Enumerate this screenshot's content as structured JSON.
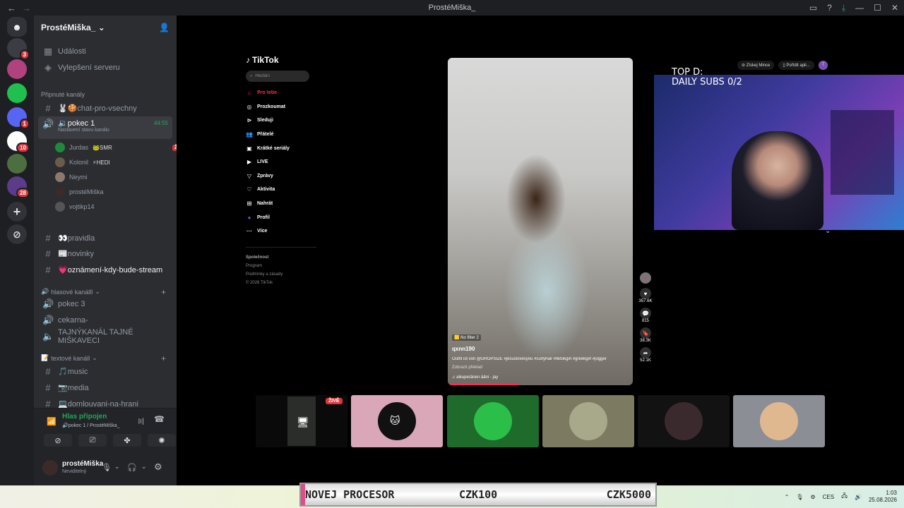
{
  "window": {
    "title": "ProstéMiška_"
  },
  "server": {
    "name": "ProstéMiška_"
  },
  "sidebar": {
    "events": "Události",
    "boost": "Vylepšení serveru",
    "pinned_category": "Připnuté kanály",
    "channels_pinned": [
      {
        "label": "🐰🍪chat-pro-vsechny"
      }
    ],
    "voice_active": {
      "label": "pokec 1",
      "status": "Nastavení stavu kanálu",
      "timer": "44:55"
    },
    "voice_users": [
      {
        "name": "Jurdas",
        "tag": "SMR",
        "live": "ŽIVĚ"
      },
      {
        "name": "Kolonil",
        "tag": "HEDI"
      },
      {
        "name": "Neymi"
      },
      {
        "name": "prostéMiška"
      },
      {
        "name": "vojtikp14"
      }
    ],
    "channels_text": [
      {
        "label": "👀pravidla"
      },
      {
        "label": "📰novinky"
      },
      {
        "label": "💗oznámení-kdy-bude-stream"
      }
    ],
    "voice_category": "hlasové kanálll",
    "voice_channels": [
      {
        "label": "pokec 3"
      },
      {
        "label": "cekarna-"
      },
      {
        "label": "TAJNÝKANÁL TAJNÉ MIŠKAVECI"
      }
    ],
    "text_category": "textové kanáll",
    "text_channels": [
      {
        "label": "🎵music"
      },
      {
        "label": "📷media"
      },
      {
        "label": "💻domlouvani-na-hrani"
      }
    ]
  },
  "voice_panel": {
    "status": "Hlas připojen",
    "channel": "pokec 1 / ProstéMiška_"
  },
  "user_panel": {
    "name": "prostéMiška",
    "status": "Neviditelný"
  },
  "servers": [
    {
      "badge": "3",
      "color": "#3b3d44"
    },
    {
      "badge": "",
      "color": "#b0427d"
    },
    {
      "badge": "",
      "color": "#20c050"
    },
    {
      "badge": "1",
      "color": "#5865f2"
    },
    {
      "badge": "10",
      "color": "#ffffff"
    },
    {
      "badge": "",
      "color": "#4d6e3f"
    },
    {
      "badge": "28",
      "color": "#5a3c8a"
    }
  ],
  "tiktok": {
    "logo": "TikTok",
    "search_placeholder": "Hledání",
    "menu": [
      {
        "label": "Pro tebe",
        "icon": "home-icon"
      },
      {
        "label": "Prozkoumat",
        "icon": "compass-icon"
      },
      {
        "label": "Sleduji",
        "icon": "following-icon"
      },
      {
        "label": "Přátelé",
        "icon": "friends-icon"
      },
      {
        "label": "Krátké seriály",
        "icon": "series-icon"
      },
      {
        "label": "LIVE",
        "icon": "live-icon"
      },
      {
        "label": "Zprávy",
        "icon": "messages-icon"
      },
      {
        "label": "Aktivita",
        "icon": "activity-icon"
      },
      {
        "label": "Nahrát",
        "icon": "upload-icon"
      },
      {
        "label": "Profil",
        "icon": "profile-icon"
      },
      {
        "label": "Více",
        "icon": "more-icon"
      }
    ],
    "footer": [
      "Společnost",
      "Program",
      "Podmínky a zásady",
      "© 2026 TikTok"
    ],
    "video": {
      "filter": "No filter 2",
      "username": "qxnn190",
      "caption": "Outfit ist von @DROPSIZE #jesuslovesyou #curlyhair #tiktokgirl #greekgirl #jogger",
      "translate": "Zobrazit překlad",
      "sound": "aikuperänen ääni - jay"
    },
    "counts": {
      "likes": "357.6K",
      "comments": "815",
      "saves": "38.3K",
      "shares": "52.1K"
    }
  },
  "stream_overlay": {
    "line1": "TOP D:",
    "line2": "DAILY SUBS 0/2",
    "pill1": "Získej Mince",
    "pill2": "Pořídit apli..."
  },
  "thumbnail_live": "ŽIVĚ",
  "ticker": {
    "left": "NOVEJ PROCESOR",
    "mid": "CZK100",
    "right": "CZK5000"
  },
  "tray": {
    "lang": "CES",
    "time": "1:03",
    "date": "25.08.2026"
  }
}
